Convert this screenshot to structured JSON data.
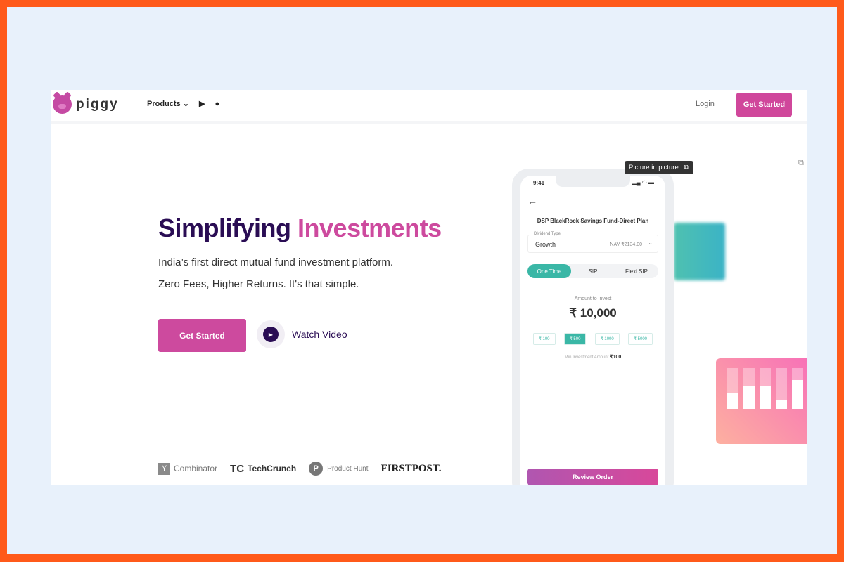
{
  "header": {
    "brand": "piggy",
    "products_label": "Products",
    "login_label": "Login",
    "get_started_label": "Get Started"
  },
  "hero": {
    "title_part1": "Simplifying",
    "title_part2": "Investments",
    "subtitle1": "India’s first direct mutual fund investment platform.",
    "subtitle2": "Zero Fees, Higher Returns. It's that simple.",
    "cta_label": "Get Started",
    "watch_label": "Watch Video"
  },
  "press": {
    "ycombinator": "Combinator",
    "yc_letter": "Y",
    "techcrunch": "TechCrunch",
    "producthunt": "Product Hunt",
    "ph_letter": "P",
    "firstpost": "FIRSTPOST."
  },
  "pip": {
    "label": "Picture in picture"
  },
  "phone": {
    "time": "9:41",
    "fund": "DSP BlackRock Savings Fund-Direct Plan",
    "dividend_label": "Dividend Type",
    "dividend_value": "Growth",
    "nav": "NAV ₹2134.00",
    "tabs": [
      "One Time",
      "SIP",
      "Flexi SIP"
    ],
    "active_tab": "One Time",
    "amount_label": "Amount to Invest",
    "amount": "₹ 10,000",
    "chips": [
      "₹ 100",
      "₹ 500",
      "₹ 1000",
      "₹ 5000"
    ],
    "selected_chip": "₹ 500",
    "min_label": "Min Investment Amount",
    "min_value": "₹100",
    "review_label": "Review Order"
  },
  "bar_card_levels": [
    0.4,
    0.55,
    0.55,
    0.2,
    0.7
  ],
  "colors": {
    "accent": "#cd4a9e",
    "dark": "#2a0d54",
    "teal": "#3ab7a6",
    "border": "#ff5a1a",
    "background": "#e8f1fb"
  }
}
